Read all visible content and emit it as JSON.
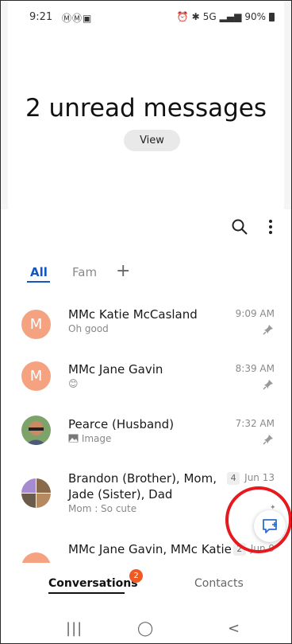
{
  "status_bar": {
    "time": "9:21",
    "left_icons": "ⓂⓂ▣",
    "right_text": "5G",
    "battery": "90%"
  },
  "header": {
    "title": "2 unread messages",
    "view_button": "View"
  },
  "tabs": {
    "all": "All",
    "fam": "Fam",
    "add": "+"
  },
  "conversations": [
    {
      "avatar_letter": "M",
      "name": "MMc Katie McCasland",
      "preview": "Oh good",
      "time": "9:09 AM",
      "pinned": true
    },
    {
      "avatar_letter": "M",
      "name": "MMc Jane Gavin",
      "preview": "😊",
      "time": "8:39 AM",
      "pinned": true
    },
    {
      "avatar_letter": "",
      "name": "Pearce (Husband)",
      "preview": "Image",
      "time": "7:32 AM",
      "pinned": true
    },
    {
      "avatar_letter": "",
      "name": "Brandon (Brother), Mom,",
      "name2": "Jade (Sister), Dad",
      "preview": "Mom : So cute",
      "count": "4",
      "time": "Jun 13"
    },
    {
      "avatar_letter": "",
      "name": "MMc Jane Gavin, MMc Katie",
      "count": "2",
      "time": "Jun 9"
    }
  ],
  "bottom_tabs": {
    "conversations": "Conversations",
    "conversations_badge": "2",
    "contacts": "Contacts"
  },
  "nav": {
    "recents": "|||",
    "home": "◯",
    "back": "<"
  }
}
